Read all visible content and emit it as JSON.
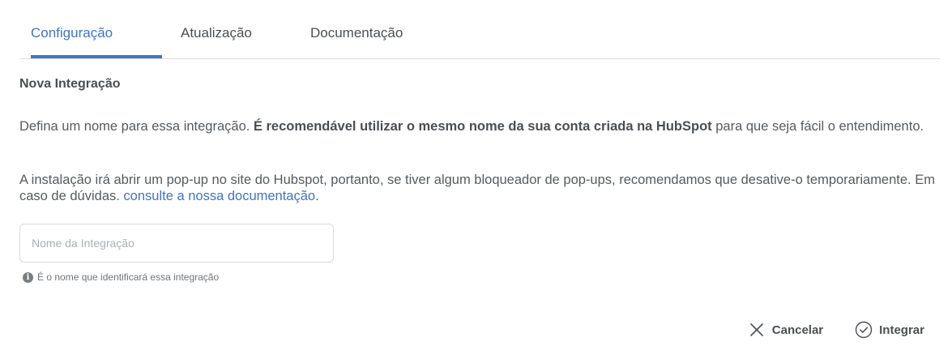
{
  "tabs": [
    {
      "label": "Configuração"
    },
    {
      "label": "Atualização"
    },
    {
      "label": "Documentação"
    }
  ],
  "section": {
    "title": "Nova Integração"
  },
  "paragraph1": {
    "text_before": "Defina um nome para essa integração. ",
    "bold": "É recomendável utilizar o mesmo nome da sua conta criada na HubSpot",
    "text_after": " para que seja fácil o entendimento."
  },
  "paragraph2": {
    "text": "A instalação irá abrir um pop-up no site do Hubspot, portanto, se tiver algum bloqueador de pop-ups, recomendamos que desative-o temporariamente. Em caso de dúvidas. ",
    "link": "consulte a nossa documentação",
    "after_link": "."
  },
  "integration_name": {
    "placeholder": "Nome da Integração",
    "value": "",
    "hint": "É o nome que identificará essa integração",
    "hint_icon": "info-icon"
  },
  "actions": {
    "cancel_label": "Cancelar",
    "cancel_icon": "close-icon",
    "integrate_label": "Integrar",
    "integrate_icon": "check-circle-icon"
  },
  "colors": {
    "accent": "#3f74c5",
    "text": "#4a4f55",
    "border": "#d9dde2"
  }
}
